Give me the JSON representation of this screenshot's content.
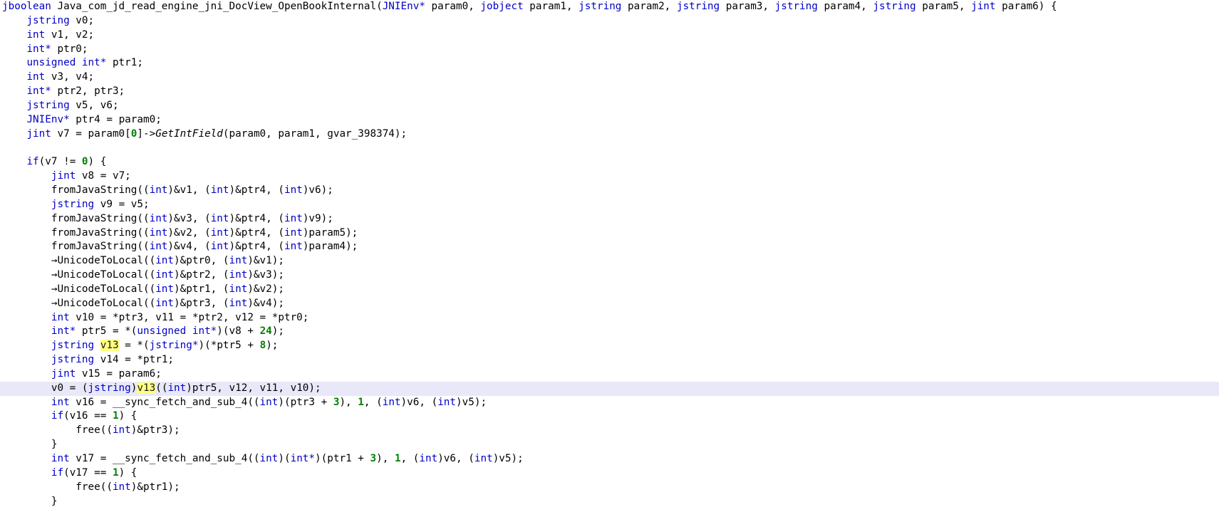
{
  "colors": {
    "keyword": "#0000c8",
    "number": "#008000",
    "highlight": "#ffff80",
    "current_line": "#e8e8f8",
    "text": "#000000"
  },
  "code": {
    "lines": [
      [
        [
          "kw",
          "jboolean"
        ],
        [
          "id",
          " Java_com_jd_read_engine_jni_DocView_OpenBookInternal("
        ],
        [
          "kw",
          "JNIEnv*"
        ],
        [
          "id",
          " param0, "
        ],
        [
          "kw",
          "jobject"
        ],
        [
          "id",
          " param1, "
        ],
        [
          "kw",
          "jstring"
        ],
        [
          "id",
          " param2, "
        ],
        [
          "kw",
          "jstring"
        ],
        [
          "id",
          " param3, "
        ],
        [
          "kw",
          "jstring"
        ],
        [
          "id",
          " param4, "
        ],
        [
          "kw",
          "jstring"
        ],
        [
          "id",
          " param5, "
        ],
        [
          "kw",
          "jint"
        ],
        [
          "id",
          " param6) {"
        ]
      ],
      [
        [
          "id",
          "    "
        ],
        [
          "kw",
          "jstring"
        ],
        [
          "id",
          " v0;"
        ]
      ],
      [
        [
          "id",
          "    "
        ],
        [
          "kw",
          "int"
        ],
        [
          "id",
          " v1, v2;"
        ]
      ],
      [
        [
          "id",
          "    "
        ],
        [
          "kw",
          "int*"
        ],
        [
          "id",
          " ptr0;"
        ]
      ],
      [
        [
          "id",
          "    "
        ],
        [
          "kw",
          "unsigned int*"
        ],
        [
          "id",
          " ptr1;"
        ]
      ],
      [
        [
          "id",
          "    "
        ],
        [
          "kw",
          "int"
        ],
        [
          "id",
          " v3, v4;"
        ]
      ],
      [
        [
          "id",
          "    "
        ],
        [
          "kw",
          "int*"
        ],
        [
          "id",
          " ptr2, ptr3;"
        ]
      ],
      [
        [
          "id",
          "    "
        ],
        [
          "kw",
          "jstring"
        ],
        [
          "id",
          " v5, v6;"
        ]
      ],
      [
        [
          "id",
          "    "
        ],
        [
          "kw",
          "JNIEnv*"
        ],
        [
          "id",
          " ptr4 = param0;"
        ]
      ],
      [
        [
          "id",
          "    "
        ],
        [
          "kw",
          "jint"
        ],
        [
          "id",
          " v7 = param0["
        ],
        [
          "num",
          "0"
        ],
        [
          "id",
          "]->"
        ],
        [
          "ital",
          "GetIntField"
        ],
        [
          "id",
          "(param0, param1, gvar_398374);"
        ]
      ],
      [],
      [
        [
          "id",
          "    "
        ],
        [
          "kw",
          "if"
        ],
        [
          "id",
          "(v7 != "
        ],
        [
          "num",
          "0"
        ],
        [
          "id",
          ") {"
        ]
      ],
      [
        [
          "id",
          "        "
        ],
        [
          "kw",
          "jint"
        ],
        [
          "id",
          " v8 = v7;"
        ]
      ],
      [
        [
          "id",
          "        fromJavaString(("
        ],
        [
          "kw",
          "int"
        ],
        [
          "id",
          ")&v1, ("
        ],
        [
          "kw",
          "int"
        ],
        [
          "id",
          ")&ptr4, ("
        ],
        [
          "kw",
          "int"
        ],
        [
          "id",
          ")v6);"
        ]
      ],
      [
        [
          "id",
          "        "
        ],
        [
          "kw",
          "jstring"
        ],
        [
          "id",
          " v9 = v5;"
        ]
      ],
      [
        [
          "id",
          "        fromJavaString(("
        ],
        [
          "kw",
          "int"
        ],
        [
          "id",
          ")&v3, ("
        ],
        [
          "kw",
          "int"
        ],
        [
          "id",
          ")&ptr4, ("
        ],
        [
          "kw",
          "int"
        ],
        [
          "id",
          ")v9);"
        ]
      ],
      [
        [
          "id",
          "        fromJavaString(("
        ],
        [
          "kw",
          "int"
        ],
        [
          "id",
          ")&v2, ("
        ],
        [
          "kw",
          "int"
        ],
        [
          "id",
          ")&ptr4, ("
        ],
        [
          "kw",
          "int"
        ],
        [
          "id",
          ")param5);"
        ]
      ],
      [
        [
          "id",
          "        fromJavaString(("
        ],
        [
          "kw",
          "int"
        ],
        [
          "id",
          ")&v4, ("
        ],
        [
          "kw",
          "int"
        ],
        [
          "id",
          ")&ptr4, ("
        ],
        [
          "kw",
          "int"
        ],
        [
          "id",
          ")param4);"
        ]
      ],
      [
        [
          "id",
          "        →UnicodeToLocal(("
        ],
        [
          "kw",
          "int"
        ],
        [
          "id",
          ")&ptr0, ("
        ],
        [
          "kw",
          "int"
        ],
        [
          "id",
          ")&v1);"
        ]
      ],
      [
        [
          "id",
          "        →UnicodeToLocal(("
        ],
        [
          "kw",
          "int"
        ],
        [
          "id",
          ")&ptr2, ("
        ],
        [
          "kw",
          "int"
        ],
        [
          "id",
          ")&v3);"
        ]
      ],
      [
        [
          "id",
          "        →UnicodeToLocal(("
        ],
        [
          "kw",
          "int"
        ],
        [
          "id",
          ")&ptr1, ("
        ],
        [
          "kw",
          "int"
        ],
        [
          "id",
          ")&v2);"
        ]
      ],
      [
        [
          "id",
          "        →UnicodeToLocal(("
        ],
        [
          "kw",
          "int"
        ],
        [
          "id",
          ")&ptr3, ("
        ],
        [
          "kw",
          "int"
        ],
        [
          "id",
          ")&v4);"
        ]
      ],
      [
        [
          "id",
          "        "
        ],
        [
          "kw",
          "int"
        ],
        [
          "id",
          " v10 = *ptr3, v11 = *ptr2, v12 = *ptr0;"
        ]
      ],
      [
        [
          "id",
          "        "
        ],
        [
          "kw",
          "int*"
        ],
        [
          "id",
          " ptr5 = *("
        ],
        [
          "kw",
          "unsigned int*"
        ],
        [
          "id",
          ")(v8 + "
        ],
        [
          "num",
          "24"
        ],
        [
          "id",
          ");"
        ]
      ],
      [
        [
          "id",
          "        "
        ],
        [
          "kw",
          "jstring"
        ],
        [
          "id",
          " "
        ],
        [
          "hl",
          "v13"
        ],
        [
          "id",
          " = *("
        ],
        [
          "kw",
          "jstring*"
        ],
        [
          "id",
          ")(*ptr5 + "
        ],
        [
          "num",
          "8"
        ],
        [
          "id",
          ");"
        ]
      ],
      [
        [
          "id",
          "        "
        ],
        [
          "kw",
          "jstring"
        ],
        [
          "id",
          " v14 = *ptr1;"
        ]
      ],
      [
        [
          "id",
          "        "
        ],
        [
          "kw",
          "jint"
        ],
        [
          "id",
          " v15 = param6;"
        ]
      ],
      [
        [
          "id",
          "        v0 = ("
        ],
        [
          "kw",
          "jstring"
        ],
        [
          "id",
          ")"
        ],
        [
          "hl",
          "v13"
        ],
        [
          "id",
          "(("
        ],
        [
          "kw",
          "int"
        ],
        [
          "id",
          ")ptr5, v12, v11, v10);"
        ]
      ],
      [
        [
          "id",
          "        "
        ],
        [
          "kw",
          "int"
        ],
        [
          "id",
          " v16 = __sync_fetch_and_sub_4(("
        ],
        [
          "kw",
          "int"
        ],
        [
          "id",
          ")(ptr3 + "
        ],
        [
          "num",
          "3"
        ],
        [
          "id",
          "), "
        ],
        [
          "num",
          "1"
        ],
        [
          "id",
          ", ("
        ],
        [
          "kw",
          "int"
        ],
        [
          "id",
          ")v6, ("
        ],
        [
          "kw",
          "int"
        ],
        [
          "id",
          ")v5);"
        ]
      ],
      [
        [
          "id",
          "        "
        ],
        [
          "kw",
          "if"
        ],
        [
          "id",
          "(v16 == "
        ],
        [
          "num",
          "1"
        ],
        [
          "id",
          ") {"
        ]
      ],
      [
        [
          "id",
          "            free(("
        ],
        [
          "kw",
          "int"
        ],
        [
          "id",
          ")&ptr3);"
        ]
      ],
      [
        [
          "id",
          "        }"
        ]
      ],
      [
        [
          "id",
          "        "
        ],
        [
          "kw",
          "int"
        ],
        [
          "id",
          " v17 = __sync_fetch_and_sub_4(("
        ],
        [
          "kw",
          "int"
        ],
        [
          "id",
          ")("
        ],
        [
          "kw",
          "int*"
        ],
        [
          "id",
          ")(ptr1 + "
        ],
        [
          "num",
          "3"
        ],
        [
          "id",
          "), "
        ],
        [
          "num",
          "1"
        ],
        [
          "id",
          ", ("
        ],
        [
          "kw",
          "int"
        ],
        [
          "id",
          ")v6, ("
        ],
        [
          "kw",
          "int"
        ],
        [
          "id",
          ")v5);"
        ]
      ],
      [
        [
          "id",
          "        "
        ],
        [
          "kw",
          "if"
        ],
        [
          "id",
          "(v17 == "
        ],
        [
          "num",
          "1"
        ],
        [
          "id",
          ") {"
        ]
      ],
      [
        [
          "id",
          "            free(("
        ],
        [
          "kw",
          "int"
        ],
        [
          "id",
          ")&ptr1);"
        ]
      ],
      [
        [
          "id",
          "        }"
        ]
      ]
    ],
    "current_line_index": 27
  }
}
